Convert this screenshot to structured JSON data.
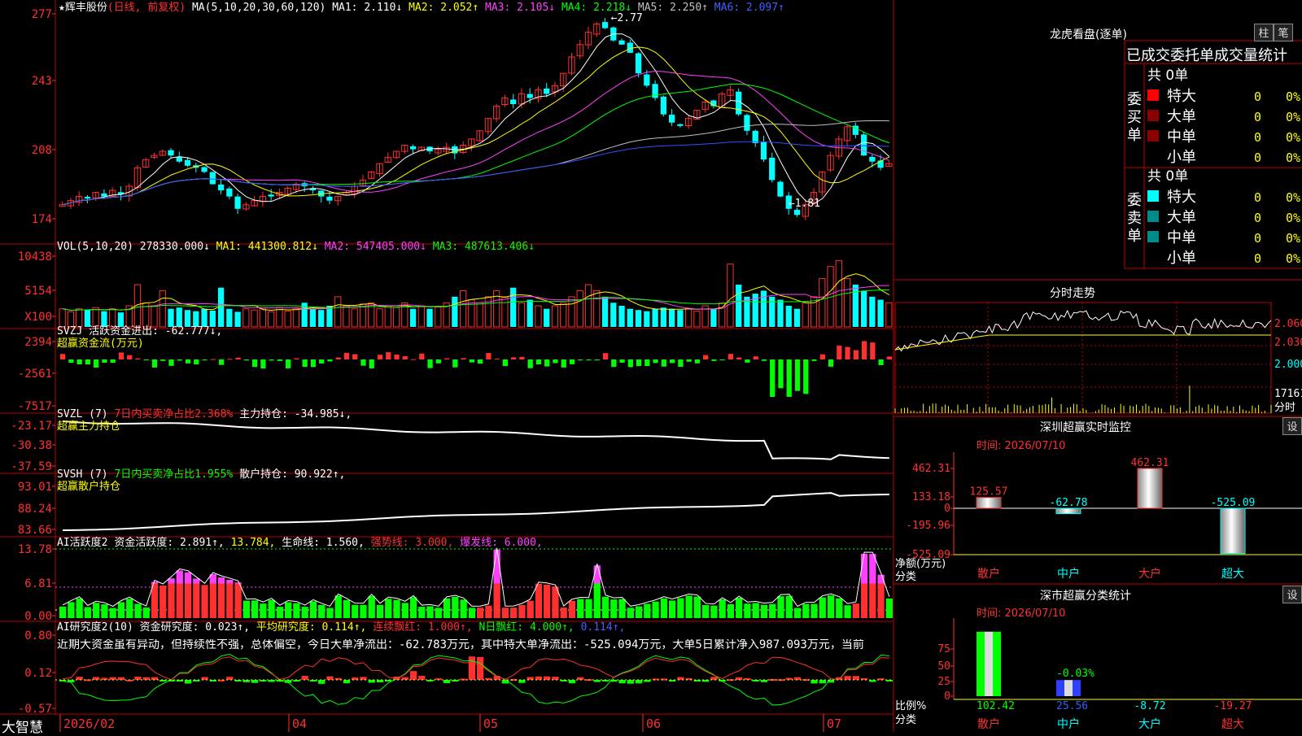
{
  "stock": {
    "name": "辉丰股份",
    "mode": "(日线, 前复权)"
  },
  "main_header": {
    "ma_title": "MA(5,10,20,30,60,120)",
    "ma": [
      {
        "t": "MA1: 2.110↓",
        "c": "#ffffff"
      },
      {
        "t": "MA2: 2.052↑",
        "c": "#ffff00"
      },
      {
        "t": "MA3: 2.105↓",
        "c": "#ff40ff"
      },
      {
        "t": "MA4: 2.218↓",
        "c": "#00ff00"
      },
      {
        "t": "MA5: 2.250↑",
        "c": "#c0c0c0"
      },
      {
        "t": "MA6: 2.097↑",
        "c": "#4060ff"
      }
    ]
  },
  "vol_header": {
    "title": "VOL(5,10,20)",
    "value": "278330.000↓",
    "items": [
      {
        "t": "MA1: 441300.812↓",
        "c": "#ffff00"
      },
      {
        "t": "MA2: 547405.000↓",
        "c": "#ff40ff"
      },
      {
        "t": "MA3: 487613.406↓",
        "c": "#00ff00"
      }
    ]
  },
  "svzj_header": {
    "title": "SVZJ",
    "label": "活跃资金进出: -62.777↓,",
    "sub": "超赢资金流(万元)"
  },
  "svzl_header": {
    "title": "SVZL (7)",
    "net": "7日内买卖净占比2.368%",
    "label": "主力持仓: -34.985↓,",
    "sub": "超赢主力持仓"
  },
  "svsh_header": {
    "title": "SVSH (7)",
    "net": "7日内买卖净占比1.955%",
    "label": "散户持仓: 90.922↑,",
    "sub": "超赢散户持仓"
  },
  "ai_header": {
    "title": "AI活跃度2",
    "a": "资金活跃度: 2.891↑,",
    "b": "13.784,",
    "c": "生命线: 1.560,",
    "d": "强势线: 3.000,",
    "e": "爆发线: 6.000,"
  },
  "ai2_header": {
    "title": "AI研究度2(10)",
    "a": "资金研究度: 0.023↑,",
    "b": "平均研究度: 0.114↑,",
    "c": "连续飘红: 1.000↑,",
    "d": "N日飘红: 4.000↑,",
    "e": "0.114↑,"
  },
  "commentary": "近期大资金虽有异动，但持续性不强，总体偏空，今日大单净流出：-62.783万元，其中特大单净流出：-525.094万元，大单5日累计净入987.093万元，当前",
  "x_axis": {
    "brand": "大智慧",
    "dates": [
      "2026/02",
      "04",
      "05",
      "06",
      "07"
    ]
  },
  "y_labels": {
    "price": [
      "277",
      "243",
      "208",
      "174"
    ],
    "vol": [
      "10438",
      "5154",
      "X100"
    ],
    "svzj": [
      "2394",
      "-2561",
      "-7517"
    ],
    "svzl": [
      "-23.17",
      "-30.38",
      "-37.59"
    ],
    "svsh": [
      "93.01",
      "88.24",
      "83.66"
    ],
    "ai": [
      "13.78",
      "6.81",
      "0.00"
    ],
    "ai2": [
      "0.80",
      "0.12",
      "-0.57"
    ]
  },
  "annotations": {
    "high": "2.77",
    "low": "1.81"
  },
  "longhu": {
    "title": "龙虎看盘(逐单)",
    "btn_a": "柱",
    "btn_b": "笔",
    "header": "已成交委托单成交量统计",
    "buy_label": [
      "委",
      "买",
      "单"
    ],
    "sell_label": [
      "委",
      "卖",
      "单"
    ],
    "buy_total": "共 0单",
    "sell_total": "共 0单",
    "rows": [
      "特大",
      "大单",
      "中单",
      "小单"
    ],
    "vals": [
      "0",
      "0",
      "0",
      "0"
    ],
    "pcts": [
      "0%",
      "0%",
      "0%",
      "0%"
    ],
    "buy_colors": [
      "#ff0000",
      "#8b0000",
      "#8b0000",
      "#000000"
    ],
    "sell_colors": [
      "#00ffff",
      "#008b8b",
      "#008b8b",
      "#000000"
    ]
  },
  "intraday": {
    "title": "分时走势",
    "prices": [
      "2.060",
      "2.030",
      "2.000"
    ],
    "vol": "17161",
    "unit": "分时"
  },
  "sz_monitor": {
    "title": "深圳超赢实时监控",
    "btn": "设",
    "time": "时间: 2026/07/10",
    "ylabels": [
      "462.31",
      "133.18",
      "0",
      "-195.96",
      "-525.09"
    ],
    "ytitle": "净额(万元)",
    "xtitle": "分类",
    "cats": [
      "散户",
      "中户",
      "大户",
      "超大"
    ],
    "values": [
      125.57,
      -62.78,
      462.31,
      -525.09
    ],
    "value_labels": [
      "125.57",
      "-62.78",
      "462.31",
      "-525.09"
    ]
  },
  "sz_class": {
    "title": "深市超赢分类统计",
    "btn": "设",
    "time": "时间: 2026/07/10",
    "ylabels": [
      "75",
      "50",
      "25",
      "0"
    ],
    "ytitle": "比例%",
    "xtitle": "分类",
    "cats": [
      "散户",
      "中户",
      "大户",
      "超大"
    ],
    "values": [
      102.42,
      25.56,
      -8.72,
      -19.27
    ],
    "value_labels": [
      "102.42",
      "25.56",
      "-8.72",
      "-19.27"
    ],
    "extra_label": "-0.03%"
  },
  "chart_data": {
    "type": "candlestick",
    "title": "辉丰股份 (日线, 前复权)",
    "x": [
      "2026/02",
      "04",
      "05",
      "06",
      "07"
    ],
    "ylim": [
      1.74,
      2.77
    ],
    "high_mark": 2.77,
    "low_mark": 1.81,
    "close_series": [
      1.86,
      1.88,
      1.9,
      1.89,
      1.92,
      1.9,
      1.93,
      1.91,
      1.95,
      2.04,
      2.08,
      2.1,
      2.12,
      2.1,
      2.07,
      2.05,
      2.04,
      2.02,
      1.96,
      1.93,
      1.9,
      1.84,
      1.86,
      1.88,
      1.9,
      1.9,
      1.92,
      1.94,
      1.96,
      1.95,
      1.93,
      1.9,
      1.88,
      1.9,
      1.92,
      1.95,
      1.98,
      2.02,
      2.06,
      2.09,
      2.12,
      2.15,
      2.13,
      2.14,
      2.12,
      2.13,
      2.14,
      2.11,
      2.15,
      2.18,
      2.22,
      2.28,
      2.34,
      2.38,
      2.35,
      2.4,
      2.38,
      2.42,
      2.4,
      2.44,
      2.5,
      2.58,
      2.64,
      2.7,
      2.74,
      2.72,
      2.66,
      2.64,
      2.6,
      2.5,
      2.44,
      2.38,
      2.3,
      2.26,
      2.25,
      2.28,
      2.32,
      2.36,
      2.34,
      2.4,
      2.42,
      2.3,
      2.22,
      2.16,
      2.08,
      1.98,
      1.9,
      1.84,
      1.81,
      1.86,
      1.92,
      2.02,
      2.1,
      2.18,
      2.24,
      2.2,
      2.1,
      2.07,
      2.04,
      2.06
    ],
    "volume_series": [
      3,
      2.5,
      3,
      2.8,
      3.2,
      2.6,
      3,
      2.4,
      3.5,
      7,
      4,
      3.5,
      6,
      3,
      3.2,
      2.8,
      2.6,
      3,
      2.7,
      6.5,
      3,
      2.5,
      3,
      2.8,
      3,
      2.5,
      3.2,
      2.6,
      3,
      4,
      3,
      2.8,
      3.5,
      5,
      3.5,
      3,
      3.8,
      4,
      3,
      3.5,
      3.2,
      4,
      3,
      3.5,
      3,
      3.3,
      4,
      5,
      6,
      4.5,
      4,
      5,
      6,
      5,
      6.5,
      4,
      4.5,
      3.5,
      3,
      3.5,
      4,
      5,
      6,
      7,
      6,
      5,
      4,
      3.5,
      3,
      2.8,
      2.6,
      3,
      3.2,
      3,
      2.8,
      3,
      2.6,
      3.5,
      3,
      4,
      10.4,
      7,
      5,
      5.5,
      6,
      5,
      4.5,
      3.5,
      3,
      4,
      5,
      8,
      10,
      11,
      8,
      7,
      6,
      5,
      4.5,
      4
    ]
  }
}
